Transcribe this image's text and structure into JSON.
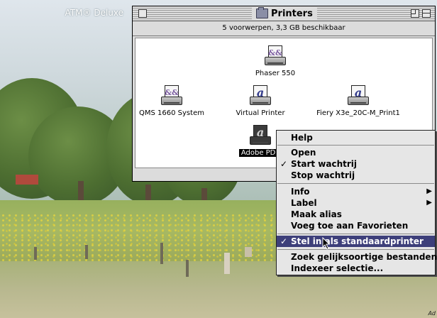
{
  "desktop": {
    "label": "ATM® Deluxe",
    "corner_mark": "Ad"
  },
  "window": {
    "title": "Printers",
    "icon": "printer-folder-icon",
    "info": "5 voorwerpen, 3,3 GB beschikbaar",
    "printers": [
      {
        "name": "Phaser 550",
        "icon": "postscript-printer-icon",
        "selected": false
      },
      {
        "name": "QMS 1660 System",
        "icon": "postscript-printer-icon",
        "selected": false
      },
      {
        "name": "Virtual Printer",
        "icon": "acrobat-printer-icon",
        "selected": false
      },
      {
        "name": "Fiery X3e_20C-M_Print1",
        "icon": "acrobat-printer-icon",
        "selected": false
      },
      {
        "name": "Adobe PDF",
        "icon": "acrobat-printer-icon",
        "selected": true
      }
    ]
  },
  "menu": {
    "items": [
      {
        "label": "Help",
        "check": "",
        "submenu": false,
        "highlighted": false
      },
      {
        "label": "Open",
        "check": "",
        "submenu": false,
        "highlighted": false
      },
      {
        "label": "Start wachtrij",
        "check": "✓",
        "submenu": false,
        "highlighted": false
      },
      {
        "label": "Stop wachtrij",
        "check": "",
        "submenu": false,
        "highlighted": false
      },
      {
        "label": "Info",
        "check": "",
        "submenu": true,
        "highlighted": false
      },
      {
        "label": "Label",
        "check": "",
        "submenu": true,
        "highlighted": false
      },
      {
        "label": "Maak alias",
        "check": "",
        "submenu": false,
        "highlighted": false
      },
      {
        "label": "Voeg toe aan Favorieten",
        "check": "",
        "submenu": false,
        "highlighted": false
      },
      {
        "label": "Stel in als standaardprinter",
        "check": "✓",
        "submenu": false,
        "highlighted": true
      },
      {
        "label": "Zoek gelijksoortige bestanden",
        "check": "",
        "submenu": false,
        "highlighted": false
      },
      {
        "label": "Indexeer selectie...",
        "check": "",
        "submenu": false,
        "highlighted": false
      }
    ],
    "submenu_arrow": "▶"
  },
  "colors": {
    "menu_highlight": "#3d3f7a",
    "window_bg": "#dcdcdc"
  }
}
